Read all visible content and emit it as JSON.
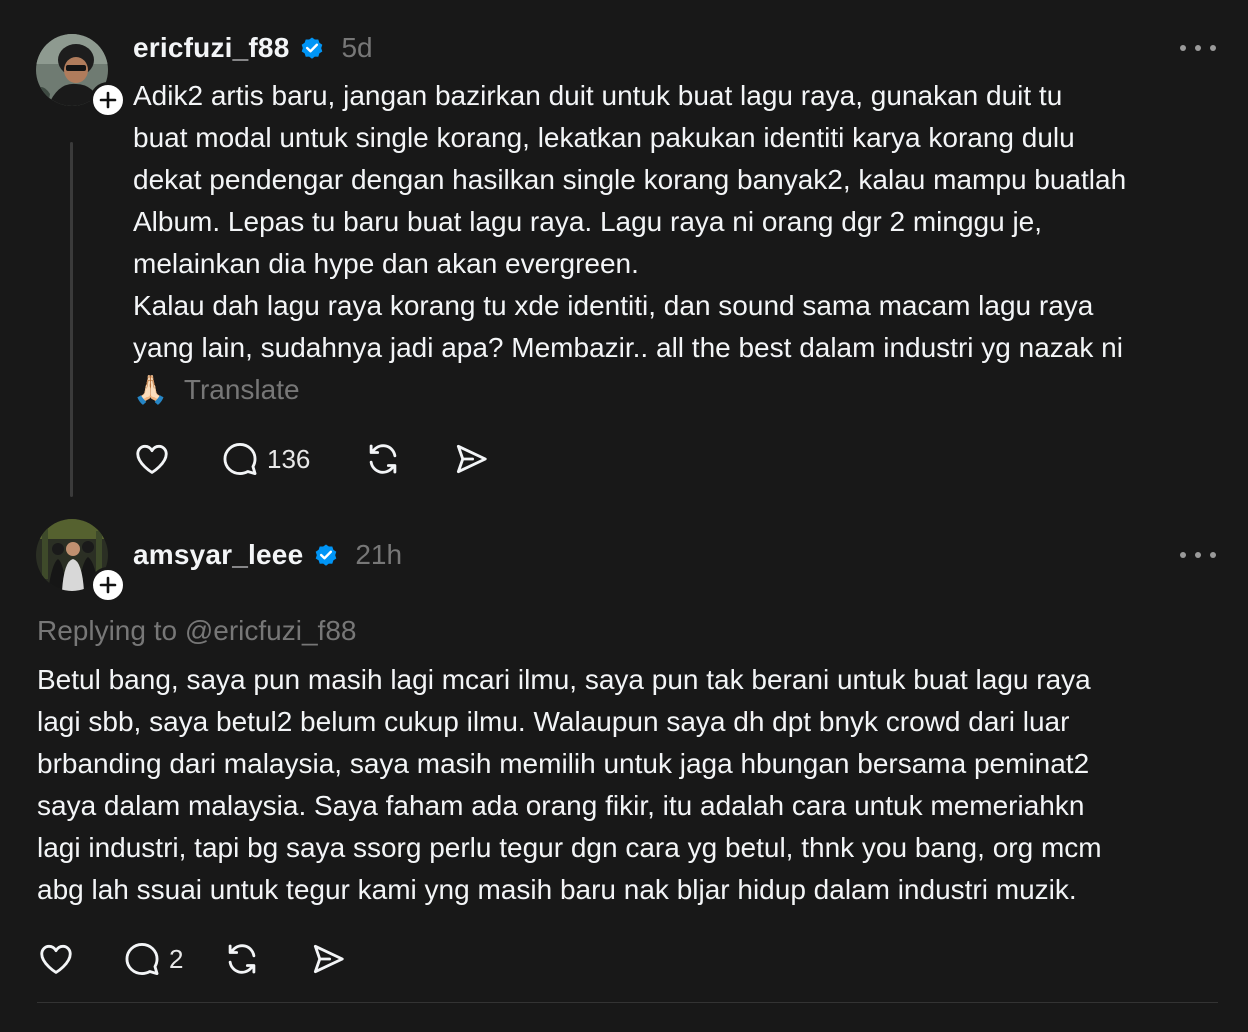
{
  "posts": [
    {
      "username": "ericfuzi_f88",
      "time": "5d",
      "paragraphs": [
        "Adik2 artis baru, jangan bazirkan duit untuk buat lagu raya, gunakan duit tu\nbuat modal untuk single korang, lekatkan pakukan identiti karya korang dulu\ndekat pendengar dengan hasilkan single korang banyak2, kalau mampu buatlah\nAlbum. Lepas tu baru buat lagu raya. Lagu raya ni orang dgr 2 minggu je,\nmelainkan dia hype dan akan evergreen.\nKalau dah lagu raya korang tu xde identiti, dan sound sama macam lagu raya\nyang lain, sudahnya jadi apa? Membazir.. all the best dalam industri yg nazak ni\n🙏🏻"
      ],
      "translate_label": "Translate",
      "reply_count": "136"
    },
    {
      "username": "amsyar_leee",
      "time": "21h",
      "replying_to": "Replying to @ericfuzi_f88",
      "text": "Betul bang, saya pun masih lagi mcari ilmu, saya pun tak berani untuk buat lagu raya\nlagi sbb, saya betul2 belum cukup ilmu. Walaupun saya dh dpt bnyk crowd dari luar\nbrbanding dari malaysia, saya masih memilih untuk jaga hbungan bersama peminat2\nsaya dalam malaysia. Saya faham ada orang fikir, itu adalah cara untuk memeriahkn\nlagi industri, tapi bg saya ssorg perlu tegur dgn cara yg betul, thnk you bang, org mcm\nabg lah ssuai untuk tegur kami yng masih baru nak bljar hidup dalam industri muzik.",
      "reply_count": "2"
    }
  ],
  "icons": {
    "like": "heart-icon",
    "reply": "comment-icon",
    "repost": "repost-icon",
    "share": "send-icon",
    "more": "more-icon",
    "verified": "verified-badge-icon",
    "follow": "plus-icon"
  },
  "colors": {
    "background": "#181818",
    "text": "#f3f5f7",
    "muted": "#777777",
    "verified": "#0095f6"
  }
}
